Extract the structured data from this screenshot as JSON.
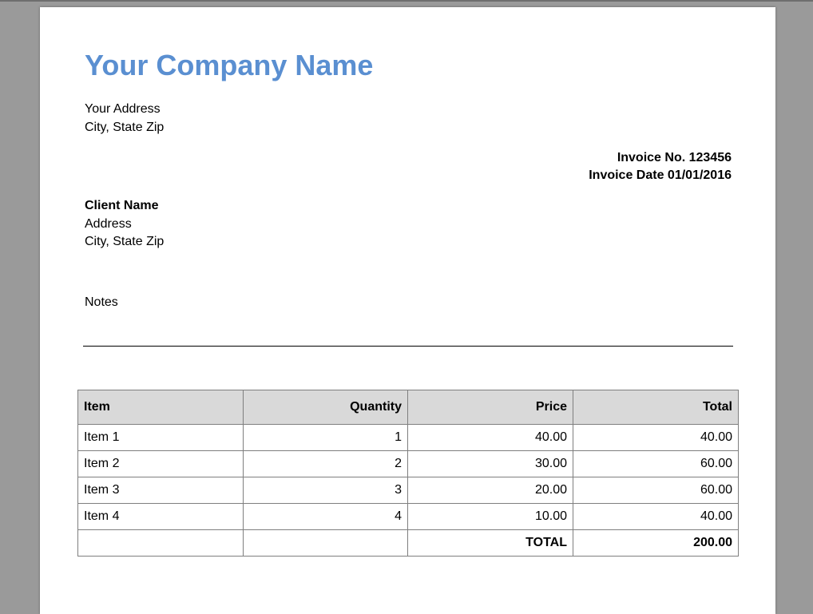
{
  "company": {
    "name": "Your Company Name",
    "address_line1": "Your Address",
    "address_line2": "City, State Zip"
  },
  "invoice": {
    "number_label": "Invoice No. 123456",
    "date_label": "Invoice Date 01/01/2016"
  },
  "client": {
    "name": "Client Name",
    "address_line1": "Address",
    "address_line2": "City, State Zip"
  },
  "notes_label": "Notes",
  "table": {
    "headers": [
      "Item",
      "Quantity",
      "Price",
      "Total"
    ],
    "rows": [
      {
        "item": "Item 1",
        "quantity": "1",
        "price": "40.00",
        "total": "40.00"
      },
      {
        "item": "Item 2",
        "quantity": "2",
        "price": "30.00",
        "total": "60.00"
      },
      {
        "item": "Item 3",
        "quantity": "3",
        "price": "20.00",
        "total": "60.00"
      },
      {
        "item": "Item 4",
        "quantity": "4",
        "price": "10.00",
        "total": "40.00"
      }
    ],
    "total_label": "TOTAL",
    "grand_total": "200.00"
  },
  "colors": {
    "company_name": "#5a8fd1",
    "header_background": "#d9d9d9",
    "viewer_background": "#9a9a9a",
    "page_background": "#ffffff"
  }
}
